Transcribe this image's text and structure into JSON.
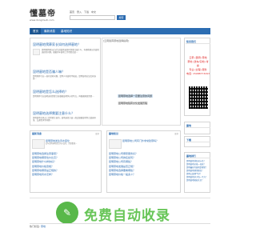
{
  "brand": {
    "title": "懂墓帝",
    "url": "www.dongmudi.com"
  },
  "top_nav": [
    "首页",
    "登入",
    "下载",
    "中文"
  ],
  "search": {
    "placeholder": "",
    "button": "搜索"
  },
  "nav": [
    "首页",
    "最新消息",
    "墓地知识"
  ],
  "main": {
    "articles": [
      {
        "title": "昆明墓地殡葬家长如何选择墓地？",
        "text": "昆明殡葬家长在对生前墓地选择时需要注意什么，有哪些家长的墓地选择的问题，根据多年墓地工作经验总结…"
      },
      {
        "title": "昆明墓地是否骗人嘛？",
        "text": "昆明殡葬行业一直有某些问题，昆明人有墓地不能进，昆明墓地应该怎样选择…"
      },
      {
        "title": "昆明墓地是怎么选择的？",
        "text": "昆明殡葬行业墓地选择需要注意根据墓地风水的特点，再根据家庭需要…"
      },
      {
        "title": "昆明墓地选择需要注意什么？",
        "text": "昆明墓地在风水上是需要注意的，墓地选择方面一般会根据墓地特点墓园环境、交通需求等问题…"
      }
    ]
  },
  "slider": {
    "image_alt": "[云南殡葬墓地选择指南]",
    "caption1": "昆明墓地选择一定要注意的问题",
    "caption2": "昆明墓地殡葬文化发展历程"
  },
  "sidebar": {
    "contact_title": "联系我们",
    "contact_lines": [
      "云墓 (昆明) 墓地",
      "墓地 (送车/实地) 考察",
      "专业 (全程) 服务",
      "电话: 15088773293"
    ],
    "box2_title": "墓地",
    "box3_title": "下载",
    "box4_title": "墓地排行",
    "list": [
      "昆明墓地排名前十名？",
      "昆明墓地价格一览表？",
      "昆明最好的墓地是哪里？",
      "昆明墓地哪里便宜？",
      "昆明公墓哪个好？",
      "昆明墓地多少钱一平方？",
      "昆明墓地陵园大全？"
    ]
  },
  "columns": [
    {
      "title": "最新消息",
      "more": "更多",
      "head": "昆明墓地发生风水变化",
      "desc": "近年昆明墓地发生风水变化，需要重视…",
      "items": [
        "昆明墓地选择注意事项？",
        "昆明墓地哪家性价比高？",
        "昆明墓地什么样的好？",
        "昆明墓地价格涨幅？",
        "昆明墓地哪家是正规的？",
        "昆明墓地风水怎样？"
      ]
    },
    {
      "title": "墓地知识",
      "more": "更多",
      "head": "昆明墓地公司有门外非常建墓吗？",
      "desc": "",
      "items": [
        "昆明墓地公司哪家服务好？",
        "昆明墓地公司排名如何？",
        "昆明墓地公司有哪些？",
        "昆明墓地发展是否正规？",
        "昆明墓地选择要看哪些？",
        "昆明墓地价格一般多少？"
      ]
    }
  ],
  "links": {
    "label": "热门标签",
    "value": "墓地"
  },
  "watermark": {
    "text": "免费自动收录",
    "icon": "pen-icon"
  },
  "colors": {
    "accent": "#2c6db2",
    "watermark": "#4dbb3a",
    "contact": "#e02b2b"
  }
}
